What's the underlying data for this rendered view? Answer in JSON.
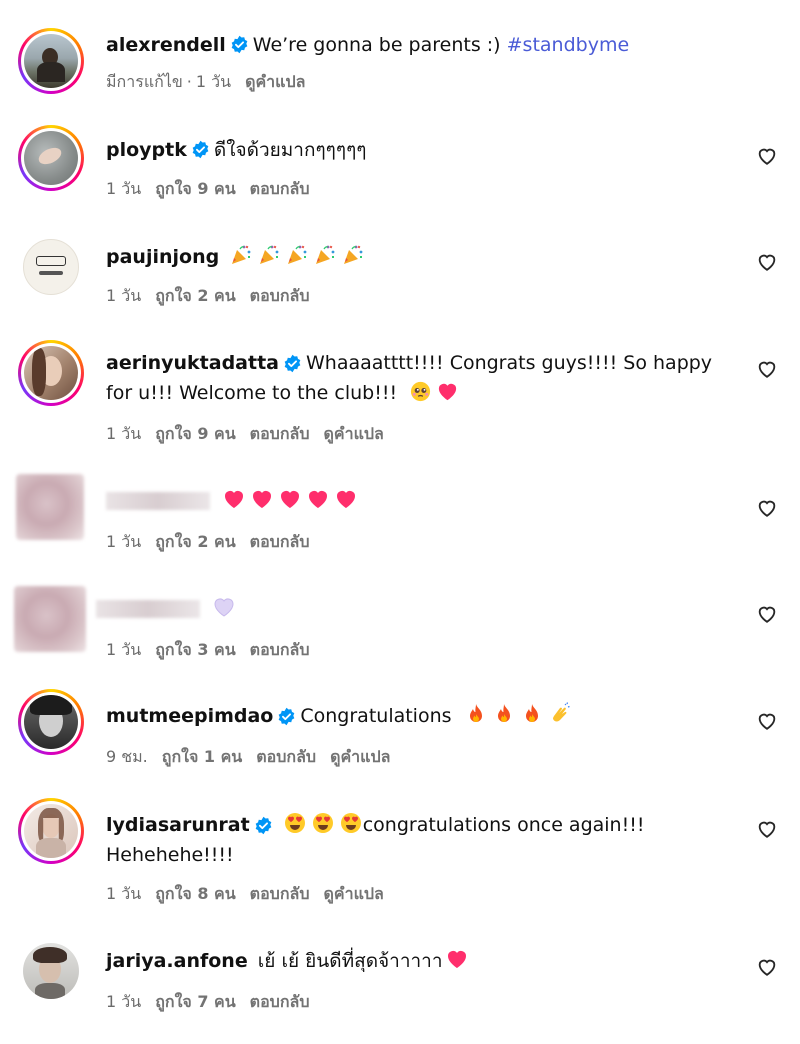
{
  "post": {
    "username": "alexrendell",
    "caption": "We’re gonna be parents :)",
    "hashtag": "#standbyme",
    "edited": "มีการแก้ไข",
    "time": "1 วัน",
    "see_translation": "ดูคำแปล"
  },
  "labels": {
    "reply": "ตอบกลับ",
    "see_translation": "ดูคำแปล"
  },
  "comments": [
    {
      "username": "ployptk",
      "verified": true,
      "text": "ดีใจด้วยมากๆๆๆๆๆ",
      "time": "1 วัน",
      "likes": "ถูกใจ 9 คน"
    },
    {
      "username": "paujinjong",
      "verified": false,
      "text": "",
      "emoji": [
        "party-popper",
        "party-popper",
        "party-popper",
        "party-popper",
        "party-popper"
      ],
      "time": "1 วัน",
      "likes": "ถูกใจ 2 คน"
    },
    {
      "username": "aerinyuktadatta",
      "verified": true,
      "text": "Whaaaatttt!!!! Congrats guys!!!! So happy for u!!! Welcome to the club!!!",
      "emoji": [
        "pleading-face",
        "pink-heart"
      ],
      "time": "1 วัน",
      "likes": "ถูกใจ 9 คน"
    },
    {
      "username": "",
      "verified": false,
      "text": "",
      "emoji": [
        "pink-heart",
        "pink-heart",
        "pink-heart",
        "pink-heart",
        "pink-heart"
      ],
      "time": "1 วัน",
      "likes": "ถูกใจ 2 คน"
    },
    {
      "username": "",
      "verified": false,
      "text": "",
      "emoji": [
        "light-purple-heart"
      ],
      "time": "1 วัน",
      "likes": "ถูกใจ 3 คน"
    },
    {
      "username": "mutmeepimdao",
      "verified": true,
      "text": "Congratulations",
      "emoji": [
        "fire",
        "fire",
        "fire",
        "clapping-hands"
      ],
      "time": "9 ชม.",
      "likes": "ถูกใจ 1 คน"
    },
    {
      "username": "lydiasarunrat",
      "verified": true,
      "text": "congratulations once again!!!",
      "text2": "Hehehehe!!!!",
      "emoji": [
        "heart-eyes",
        "heart-eyes",
        "heart-eyes"
      ],
      "time": "1 วัน",
      "likes": "ถูกใจ 8 คน"
    },
    {
      "username": "jariya.anfone",
      "verified": false,
      "text": "เย้ เย้ ยินดีที่สุดจ้าาาาา",
      "emoji": [
        "pink-heart"
      ],
      "time": "1 วัน",
      "likes": "ถูกใจ 7 คน"
    }
  ],
  "colors": {
    "verified": "#0095f6",
    "hashtag": "#4a5bd6",
    "muted": "#737373",
    "pink": "#ff2e6c"
  }
}
